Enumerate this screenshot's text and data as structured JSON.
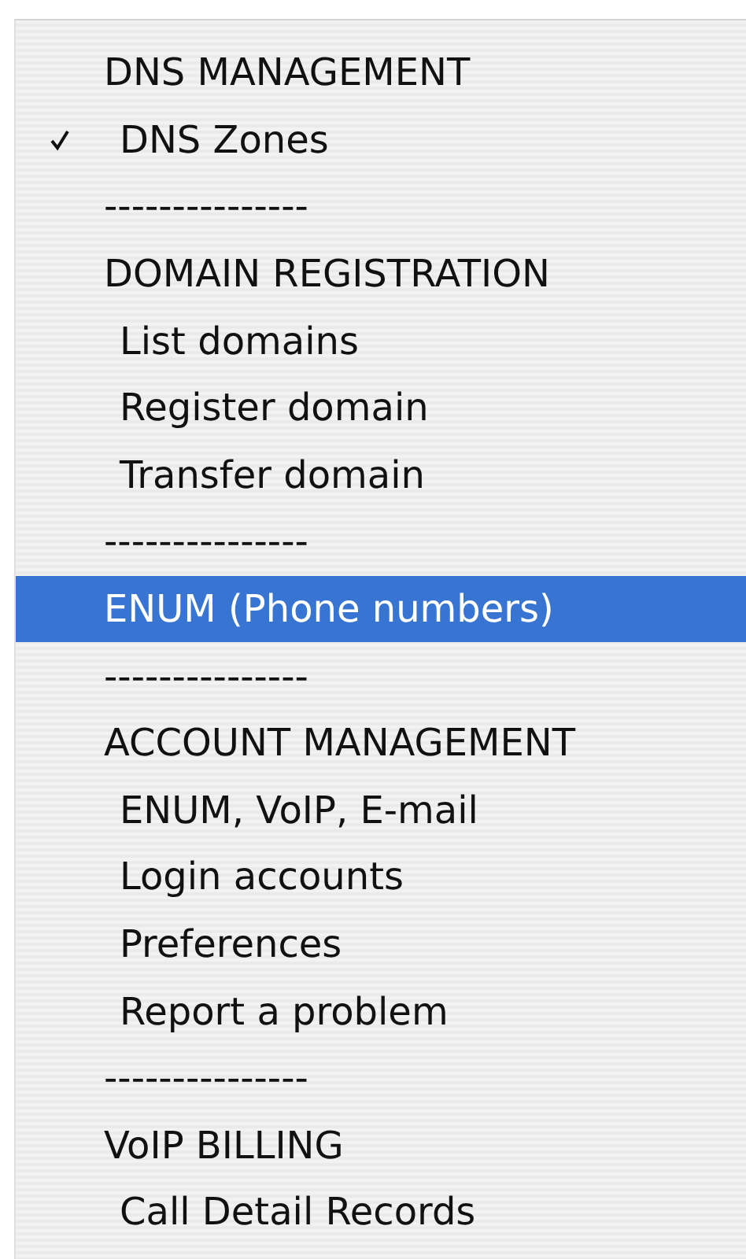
{
  "menu": {
    "items": [
      {
        "kind": "header",
        "label": "DNS MANAGEMENT",
        "checked": false,
        "selected": false
      },
      {
        "kind": "option",
        "label": "DNS Zones",
        "checked": true,
        "selected": false
      },
      {
        "kind": "separator",
        "label": "---------------",
        "checked": false,
        "selected": false
      },
      {
        "kind": "header",
        "label": "DOMAIN REGISTRATION",
        "checked": false,
        "selected": false
      },
      {
        "kind": "option",
        "label": "List domains",
        "checked": false,
        "selected": false
      },
      {
        "kind": "option",
        "label": "Register domain",
        "checked": false,
        "selected": false
      },
      {
        "kind": "option",
        "label": "Transfer domain",
        "checked": false,
        "selected": false
      },
      {
        "kind": "separator",
        "label": "---------------",
        "checked": false,
        "selected": false
      },
      {
        "kind": "header",
        "label": "ENUM (Phone numbers)",
        "checked": false,
        "selected": true
      },
      {
        "kind": "separator",
        "label": "---------------",
        "checked": false,
        "selected": false
      },
      {
        "kind": "header",
        "label": "ACCOUNT MANAGEMENT",
        "checked": false,
        "selected": false
      },
      {
        "kind": "option",
        "label": "ENUM, VoIP, E-mail",
        "checked": false,
        "selected": false
      },
      {
        "kind": "option",
        "label": "Login accounts",
        "checked": false,
        "selected": false
      },
      {
        "kind": "option",
        "label": "Preferences",
        "checked": false,
        "selected": false
      },
      {
        "kind": "option",
        "label": "Report a problem",
        "checked": false,
        "selected": false
      },
      {
        "kind": "separator",
        "label": "---------------",
        "checked": false,
        "selected": false
      },
      {
        "kind": "header",
        "label": "VoIP BILLING",
        "checked": false,
        "selected": false
      },
      {
        "kind": "option",
        "label": "Call Detail Records",
        "checked": false,
        "selected": false
      }
    ]
  }
}
